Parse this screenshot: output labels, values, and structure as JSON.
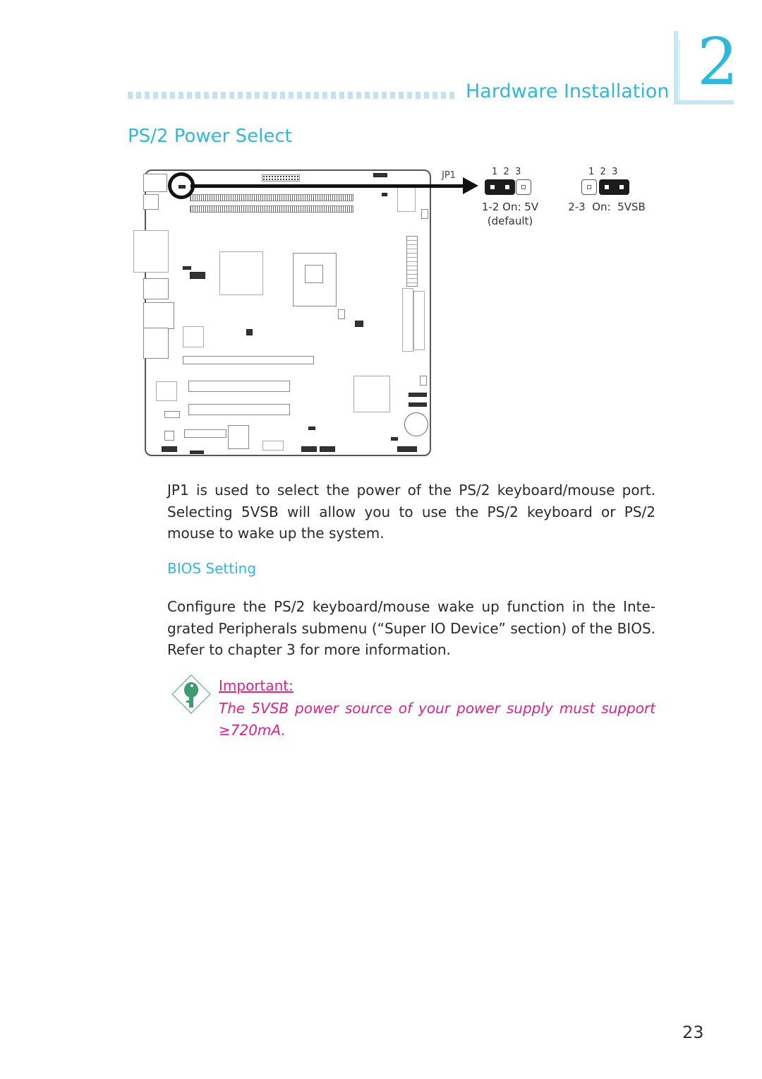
{
  "header": {
    "chapter_title": "Hardware Installation",
    "chapter_number": "2"
  },
  "section": {
    "title": "PS/2 Power Select"
  },
  "diagram": {
    "jumper_label": "JP1",
    "settings": [
      {
        "pin_numbers": "1  2  3",
        "pins_on": [
          1,
          2
        ],
        "caption": "1-2 On: 5V",
        "note": "(default)"
      },
      {
        "pin_numbers": "1  2  3",
        "pins_on": [
          2,
          3
        ],
        "caption": "2-3  On:  5VSB",
        "note": ""
      }
    ]
  },
  "body": {
    "paragraph1": "JP1 is used to select the power of the PS/2 keyboard/mouse port. Selecting 5VSB will allow you to use the PS/2 keyboard or PS/2 mouse to wake up the system.",
    "bios_heading": "BIOS Setting",
    "paragraph2": "Configure the PS/2 keyboard/mouse wake up function in the Inte-grated Peripherals submenu (“Super IO Device” section) of the BIOS. Refer to chapter 3 for more information."
  },
  "note": {
    "icon": "key-icon",
    "label": "Important:",
    "text": "The 5VSB power source of your power supply must support ≥720mA."
  },
  "footer": {
    "page_number": "23"
  },
  "colors": {
    "accent": "#2fb8d8",
    "important": "#e0218a",
    "key_icon": "#3f9a6e"
  }
}
